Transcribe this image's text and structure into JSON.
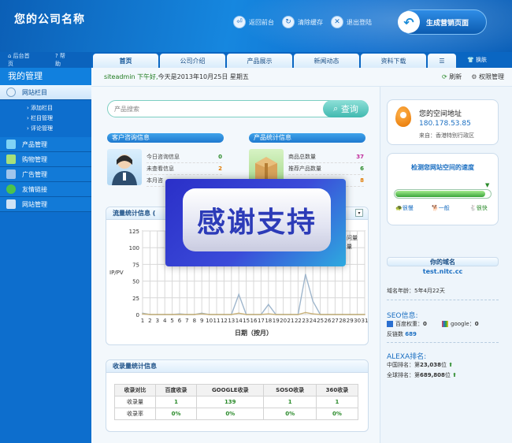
{
  "header": {
    "brand": "您的公司名称",
    "links": [
      {
        "label": "返回前台",
        "icon": "home-icon"
      },
      {
        "label": "清除缓存",
        "icon": "cache-icon"
      },
      {
        "label": "退出登陆",
        "icon": "logout-icon"
      }
    ],
    "generate_button": "生成营销页面"
  },
  "sidebar": {
    "top_links": [
      "后台首页",
      "帮助"
    ],
    "title": "我的管理",
    "items": [
      {
        "label": "网站栏目",
        "active": true
      },
      {
        "label": "产品管理"
      },
      {
        "label": "购物管理"
      },
      {
        "label": "广告管理"
      },
      {
        "label": "友情链接"
      },
      {
        "label": "网站管理"
      }
    ],
    "subitems": [
      "添加栏目",
      "栏目管理",
      "评论管理"
    ]
  },
  "tabs": [
    "首页",
    "公司介绍",
    "产品展示",
    "新闻动态",
    "资料下载"
  ],
  "skin_label": "换肤",
  "greeting": {
    "user": "siteadmin",
    "text": "下午好,",
    "date": "今天是2013年10月25日 星期五",
    "refresh": "刷新",
    "permission": "权限管理"
  },
  "search": {
    "placeholder": "产品搜索",
    "button": "查询"
  },
  "consult": {
    "title": "客户咨询信息",
    "rows": [
      {
        "label": "今日咨询信息",
        "value": "0",
        "color": "#2a8a2a"
      },
      {
        "label": "未查看信息",
        "value": "2",
        "color": "#e07a00"
      },
      {
        "label": "本月咨",
        "value": "",
        "color": "#333333"
      }
    ]
  },
  "product_stats": {
    "title": "产品统计信息",
    "rows": [
      {
        "label": "商品总数量",
        "value": "37",
        "color": "#c02a9a"
      },
      {
        "label": "推荐产品数量",
        "value": "6",
        "color": "#2a8a2a"
      },
      {
        "label": "",
        "value": "8",
        "color": "#e07a00"
      }
    ]
  },
  "traffic": {
    "title": "流量统计信息",
    "legend_fragment": [
      "问量",
      "量"
    ]
  },
  "chart_data": {
    "type": "line",
    "title": "",
    "xlabel": "日期（按月）",
    "ylabel": "IP/PV",
    "ylim": [
      0,
      125
    ],
    "yticks": [
      0,
      25,
      50,
      75,
      100,
      125
    ],
    "x": [
      1,
      2,
      3,
      4,
      5,
      6,
      7,
      8,
      9,
      10,
      11,
      12,
      13,
      14,
      15,
      16,
      17,
      18,
      19,
      20,
      21,
      22,
      23,
      24,
      25,
      26,
      27,
      28,
      29,
      30,
      31
    ],
    "series": [
      {
        "color": "#9fb6cc",
        "values": [
          2,
          0,
          0,
          0,
          0,
          1,
          0,
          0,
          2,
          0,
          0,
          0,
          0,
          30,
          0,
          0,
          0,
          15,
          0,
          0,
          0,
          0,
          60,
          20,
          0,
          0,
          0,
          0,
          0,
          0,
          0
        ]
      },
      {
        "color": "#c9b27a",
        "values": [
          1,
          0,
          0,
          0,
          0,
          0,
          0,
          0,
          1,
          0,
          0,
          0,
          0,
          2,
          0,
          0,
          0,
          1,
          0,
          0,
          0,
          0,
          3,
          1,
          0,
          0,
          0,
          0,
          0,
          0,
          0
        ]
      }
    ],
    "grid": true
  },
  "index": {
    "title": "收录量统计信息",
    "headers": [
      "收录对比",
      "百度收录",
      "GOOGLE收录",
      "SOSO收录",
      "360收录"
    ],
    "rows": [
      [
        "收录量",
        "1",
        "139",
        "1",
        "1"
      ],
      [
        "收录率",
        "0%",
        "0%",
        "0%",
        "0%"
      ]
    ]
  },
  "space": {
    "title": "您的空间地址",
    "ip": "180.178.53.85",
    "from": "来自：香港特别行政区"
  },
  "speed": {
    "title": "检测您网站空间的速度",
    "labels": [
      "很慢",
      "一般",
      "很快"
    ],
    "level": 0.95
  },
  "domain": {
    "title": "你的域名",
    "name": "test.nitc.cc",
    "age": "域名年龄：5年4月22天",
    "seo_title": "SEO信息:",
    "baidu_weight_label": "百度权重：",
    "baidu_weight": "0",
    "google_label": "google：",
    "google": "0",
    "backlinks_label": "反链数",
    "backlinks": "689",
    "alexa_title": "ALEXA排名:",
    "china_rank_label": "中国排名：第",
    "china_rank": "23,038",
    "china_rank_suffix": "位",
    "global_rank_label": "全球排名：第",
    "global_rank": "689,808",
    "global_rank_suffix": "位"
  },
  "overlay": {
    "text": "感谢支持"
  }
}
